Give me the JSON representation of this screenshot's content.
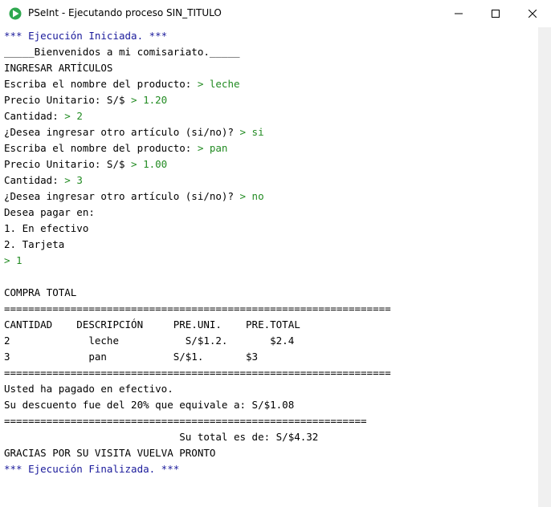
{
  "window": {
    "title": "PSeInt - Ejecutando proceso SIN_TITULO",
    "icon": "pseint-app-icon",
    "controls": [
      "minimize-icon",
      "maximize-icon",
      "close-icon"
    ]
  },
  "colors": {
    "system_text": "#1a1a9b",
    "output_text": "#000000",
    "input_text": "#228b22"
  },
  "console": {
    "lines": [
      {
        "kind": "sys",
        "text": "*** Ejecución Iniciada. ***"
      },
      {
        "kind": "out",
        "text": "_____Bienvenidos a mi comisariato._____"
      },
      {
        "kind": "out",
        "text": "INGRESAR ARTÍCULOS"
      },
      {
        "kind": "out",
        "text": "Escriba el nombre del producto: ",
        "input": "> leche"
      },
      {
        "kind": "out",
        "text": "Precio Unitario: S/$ ",
        "input": "> 1.20"
      },
      {
        "kind": "out",
        "text": "Cantidad: ",
        "input": "> 2"
      },
      {
        "kind": "out",
        "text": "¿Desea ingresar otro artículo (si/no)? ",
        "input": "> si"
      },
      {
        "kind": "out",
        "text": "Escriba el nombre del producto: ",
        "input": "> pan"
      },
      {
        "kind": "out",
        "text": "Precio Unitario: S/$ ",
        "input": "> 1.00"
      },
      {
        "kind": "out",
        "text": "Cantidad: ",
        "input": "> 3"
      },
      {
        "kind": "out",
        "text": "¿Desea ingresar otro artículo (si/no)? ",
        "input": "> no"
      },
      {
        "kind": "out",
        "text": "Desea pagar en:"
      },
      {
        "kind": "out",
        "text": "1. En efectivo"
      },
      {
        "kind": "out",
        "text": "2. Tarjeta"
      },
      {
        "kind": "out",
        "text": "",
        "input": "> 1"
      },
      {
        "kind": "out",
        "text": ""
      },
      {
        "kind": "out",
        "text": "COMPRA TOTAL"
      },
      {
        "kind": "out",
        "text": "================================================================"
      },
      {
        "kind": "out",
        "text": "CANTIDAD    DESCRIPCIÓN     PRE.UNI.    PRE.TOTAL"
      },
      {
        "kind": "out",
        "text": "2             leche           S/$1.2.       $2.4"
      },
      {
        "kind": "out",
        "text": "3             pan           S/$1.       $3"
      },
      {
        "kind": "out",
        "text": "================================================================"
      },
      {
        "kind": "out",
        "text": "Usted ha pagado en efectivo."
      },
      {
        "kind": "out",
        "text": "Su descuento fue del 20% que equivale a: S/$1.08"
      },
      {
        "kind": "out",
        "text": "============================================================"
      },
      {
        "kind": "out",
        "text": "                             Su total es de: S/$4.32"
      },
      {
        "kind": "out",
        "text": "GRACIAS POR SU VISITA VUELVA PRONTO"
      },
      {
        "kind": "sys",
        "text": "*** Ejecución Finalizada. ***"
      }
    ]
  }
}
